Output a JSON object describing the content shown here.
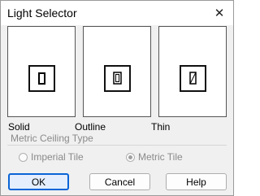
{
  "window": {
    "title": "Light Selector"
  },
  "tiles": [
    {
      "label": "Solid",
      "icon": "solid-light-icon"
    },
    {
      "label": "Outline",
      "icon": "outline-light-icon"
    },
    {
      "label": "Thin",
      "icon": "thin-light-icon"
    }
  ],
  "ceiling": {
    "label": "Metric Ceiling Type",
    "options": [
      {
        "label": "Imperial Tile",
        "selected": false
      },
      {
        "label": "Metric Tile",
        "selected": true
      }
    ]
  },
  "buttons": {
    "ok": "OK",
    "cancel": "Cancel",
    "help": "Help"
  },
  "colors": {
    "accent": "#0a64d6",
    "disabled_text": "#8a8a8a"
  }
}
